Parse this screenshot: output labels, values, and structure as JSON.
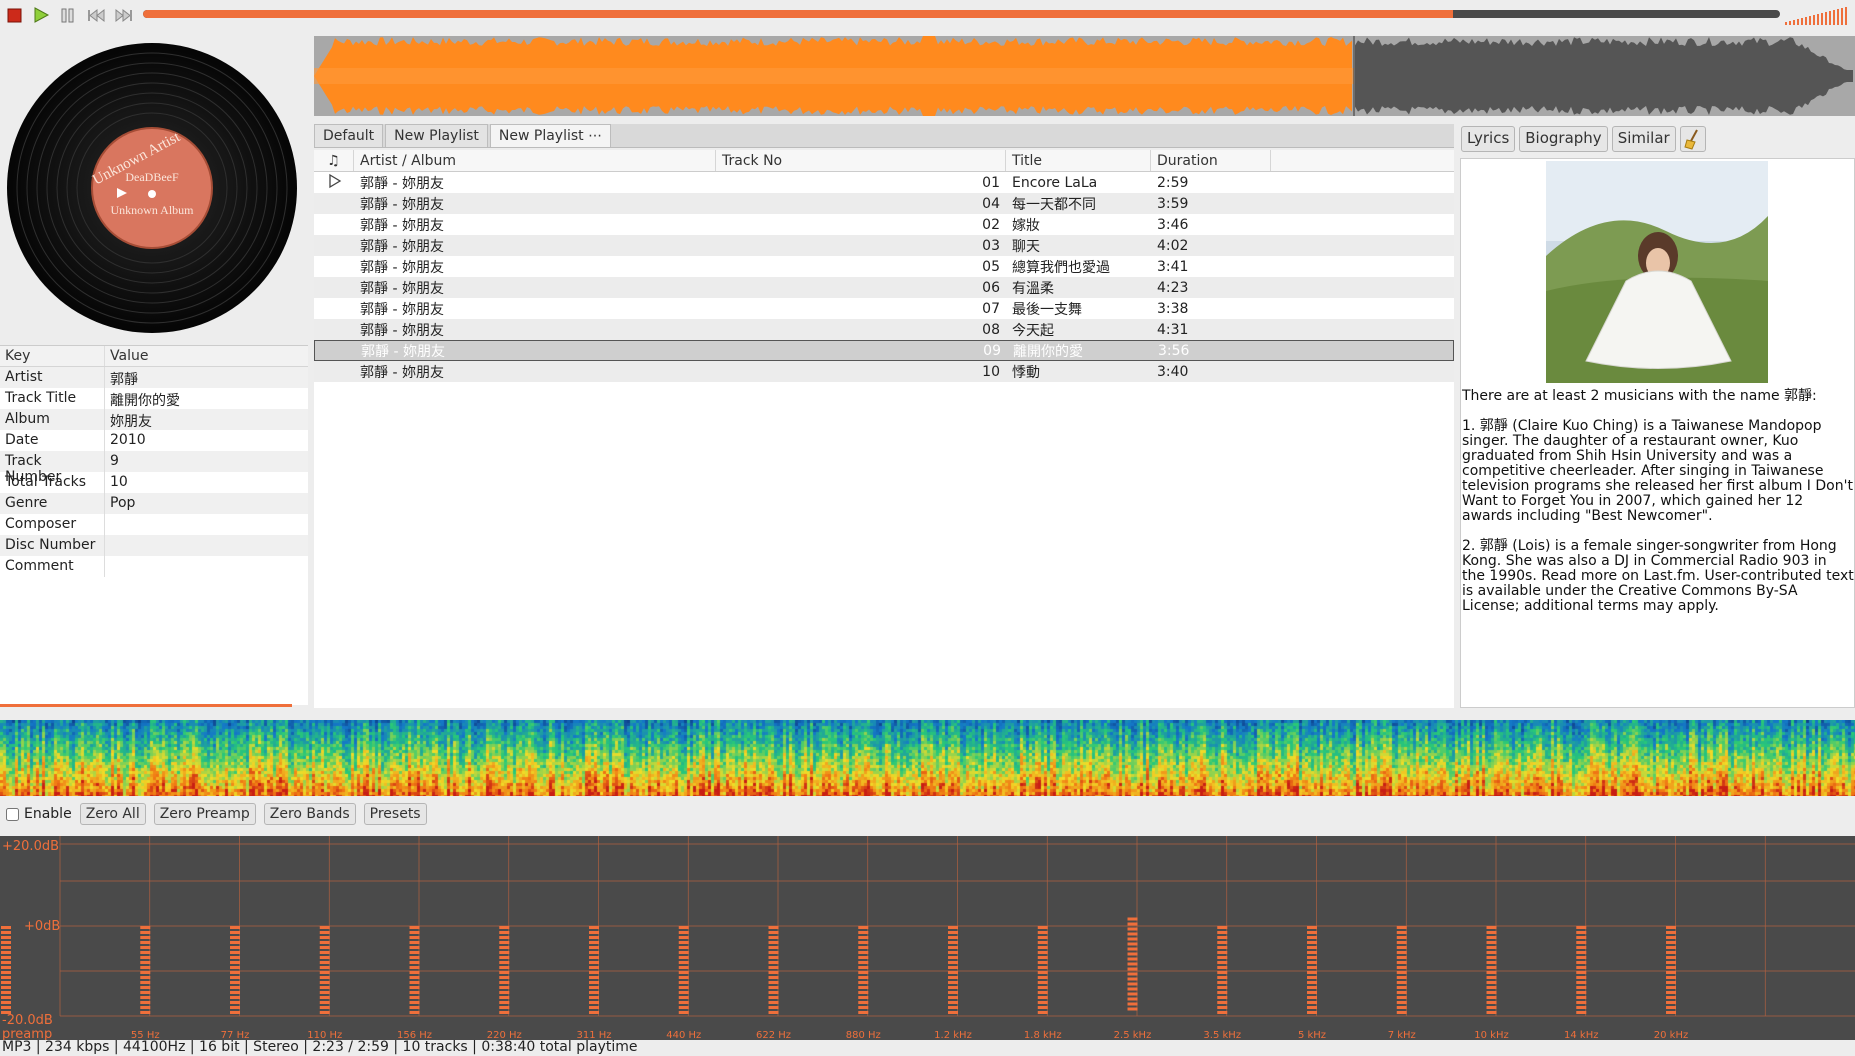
{
  "toolbar": {
    "buttons": [
      "stop",
      "play",
      "pause",
      "previous",
      "next"
    ],
    "seek_progress": 0.8,
    "accent_color": "#ef6f3b"
  },
  "album_art": {
    "artist": "Unknown Artist",
    "brand": "DeaDBeeF",
    "album": "Unknown Album"
  },
  "properties": {
    "headers": {
      "key": "Key",
      "value": "Value"
    },
    "rows": [
      {
        "key": "Artist",
        "value": "郭靜"
      },
      {
        "key": "Track Title",
        "value": "離開你的愛"
      },
      {
        "key": "Album",
        "value": "妳朋友"
      },
      {
        "key": "Date",
        "value": "2010"
      },
      {
        "key": "Track Number",
        "value": "9"
      },
      {
        "key": "Total Tracks",
        "value": "10"
      },
      {
        "key": "Genre",
        "value": "Pop"
      },
      {
        "key": "Composer",
        "value": ""
      },
      {
        "key": "Disc Number",
        "value": ""
      },
      {
        "key": "Comment",
        "value": ""
      }
    ]
  },
  "waveform": {
    "progress": 0.675,
    "played_color": "#ff8a1e",
    "unplayed_color": "#555555"
  },
  "tabs": [
    "Default",
    "New Playlist",
    "New Playlist ⋯"
  ],
  "playlist": {
    "columns": {
      "artist_album": "Artist / Album",
      "track_no": "Track No",
      "title": "Title",
      "duration": "Duration"
    },
    "rows": [
      {
        "playing": true,
        "artist_album": "郭靜 - 妳朋友",
        "track_no": "01",
        "title": "Encore LaLa",
        "duration": "2:59"
      },
      {
        "playing": false,
        "artist_album": "郭靜 - 妳朋友",
        "track_no": "04",
        "title": "每一天都不同",
        "duration": "3:59"
      },
      {
        "playing": false,
        "artist_album": "郭靜 - 妳朋友",
        "track_no": "02",
        "title": "嫁妝",
        "duration": "3:46"
      },
      {
        "playing": false,
        "artist_album": "郭靜 - 妳朋友",
        "track_no": "03",
        "title": "聊天",
        "duration": "4:02"
      },
      {
        "playing": false,
        "artist_album": "郭靜 - 妳朋友",
        "track_no": "05",
        "title": "總算我們也愛過",
        "duration": "3:41"
      },
      {
        "playing": false,
        "artist_album": "郭靜 - 妳朋友",
        "track_no": "06",
        "title": "有溫柔",
        "duration": "4:23"
      },
      {
        "playing": false,
        "artist_album": "郭靜 - 妳朋友",
        "track_no": "07",
        "title": "最後一支舞",
        "duration": "3:38"
      },
      {
        "playing": false,
        "artist_album": "郭靜 - 妳朋友",
        "track_no": "08",
        "title": "今天起",
        "duration": "4:31"
      },
      {
        "playing": false,
        "selected": true,
        "artist_album": "郭靜 - 妳朋友",
        "track_no": "09",
        "title": "離開你的愛",
        "duration": "3:56"
      },
      {
        "playing": false,
        "artist_album": "郭靜 - 妳朋友",
        "track_no": "10",
        "title": "悸動",
        "duration": "3:40"
      }
    ]
  },
  "right_panel": {
    "buttons": [
      "Lyrics",
      "Biography",
      "Similar"
    ],
    "bio": [
      "There are at least 2 musicians with the name 郭靜:",
      "1. 郭靜 (Claire Kuo Ching) is a Taiwanese Mandopop singer. The daughter of a restaurant owner, Kuo graduated from Shih Hsin University and was a competitive cheerleader. After singing in Taiwanese television programs she released her first album I Don't Want to Forget You in 2007, which gained her 12 awards including \"Best Newcomer\".",
      "2. 郭靜 (Lois) is a female singer-songwriter from Hong Kong. She was also a DJ in Commercial Radio 903 in the 1990s. Read more on Last.fm. User-contributed text is available under the Creative Commons By-SA License; additional terms may apply."
    ]
  },
  "equalizer": {
    "enable_label": "Enable",
    "enabled": false,
    "buttons": {
      "zero_all": "Zero All",
      "zero_preamp": "Zero Preamp",
      "zero_bands": "Zero Bands",
      "presets": "Presets"
    },
    "db_labels": {
      "top": "+20.0dB",
      "mid": "+0dB",
      "bottom": "-20.0dB"
    },
    "preamp_label": "preamp",
    "bands": [
      "55 Hz",
      "77 Hz",
      "110 Hz",
      "156 Hz",
      "220 Hz",
      "311 Hz",
      "440 Hz",
      "622 Hz",
      "880 Hz",
      "1.2 kHz",
      "1.8 kHz",
      "2.5 kHz",
      "3.5 kHz",
      "5 kHz",
      "7 kHz",
      "10 kHz",
      "14 kHz",
      "20 kHz"
    ],
    "band_values_db": [
      0,
      0,
      0,
      0,
      0,
      0,
      0,
      0,
      0,
      0,
      0,
      2,
      0,
      0,
      0,
      0,
      0,
      0
    ],
    "preamp_db": 0
  },
  "status": "MP3 |  234 kbps | 44100Hz | 16 bit | Stereo | 2:23 / 2:59 | 10 tracks | 0:38:40 total playtime"
}
